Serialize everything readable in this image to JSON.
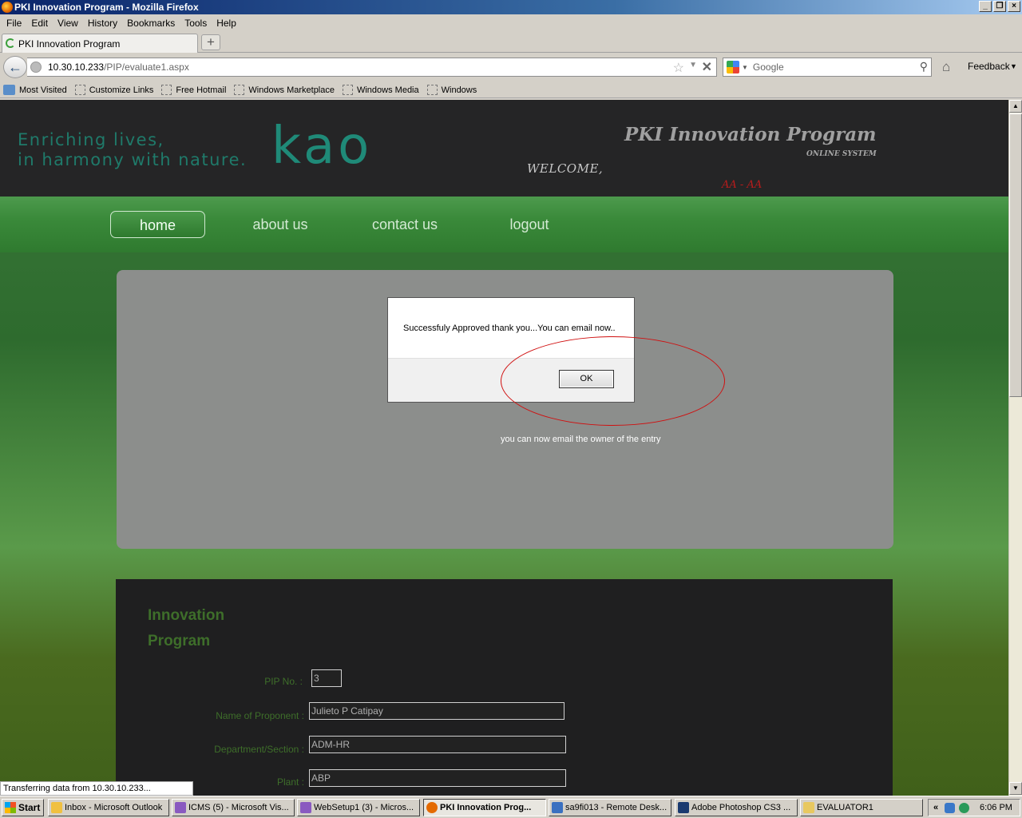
{
  "window": {
    "title": "PKI Innovation Program - Mozilla Firefox",
    "controls": [
      "_",
      "❐",
      "×"
    ]
  },
  "menubar": [
    "File",
    "Edit",
    "View",
    "History",
    "Bookmarks",
    "Tools",
    "Help"
  ],
  "tab": {
    "label": "PKI Innovation Program",
    "new_tab": "+"
  },
  "navbar": {
    "url_host": "10.30.10.233",
    "url_path": "/PIP/evaluate1.aspx",
    "search_placeholder": "Google",
    "feedback_label": "Feedback"
  },
  "bookmarks": [
    "Most Visited",
    "Customize Links",
    "Free Hotmail",
    "Windows Marketplace",
    "Windows Media",
    "Windows"
  ],
  "site": {
    "tagline_line1": "Enriching lives,",
    "tagline_line2": "in harmony with nature.",
    "logo": "kao",
    "program_title": "PKI Innovation Program",
    "online_system": "ONLINE SYSTEM",
    "welcome": "WELCOME,",
    "user": "AA - AA",
    "nav": [
      "home",
      "about us",
      "contact us",
      "logout"
    ],
    "email_note": "you can now email the owner of the entry"
  },
  "dialog": {
    "message": "Successfuly Approved thank you...You can email now..",
    "ok_label": "OK"
  },
  "form": {
    "title_line1": "Innovation",
    "title_line2": "Program",
    "pip_label": "PIP No. :",
    "pip_value": "3",
    "name_label": "Name of Proponent :",
    "name_value": "Julieto P Catipay",
    "dept_label": "Department/Section :",
    "dept_value": "ADM-HR",
    "plant_label": "Plant :",
    "plant_value": "ABP"
  },
  "status": "Transferring data from 10.30.10.233...",
  "taskbar": {
    "start": "Start",
    "tasks": [
      "Inbox - Microsoft Outlook",
      "ICMS (5) - Microsoft Vis...",
      "WebSetup1 (3) - Micros...",
      "PKI Innovation Prog...",
      "sa9fi013 - Remote Desk...",
      "Adobe Photoshop CS3 ...",
      "EVALUATOR1"
    ],
    "tray_chevron": "«",
    "clock": "6:06 PM"
  },
  "colors": {
    "header_bg": "#252526",
    "brand_teal": "#1f8a78",
    "nav_green": "#3a8a3a",
    "user_red": "#b81c1c",
    "annotation_red": "#d01010"
  }
}
